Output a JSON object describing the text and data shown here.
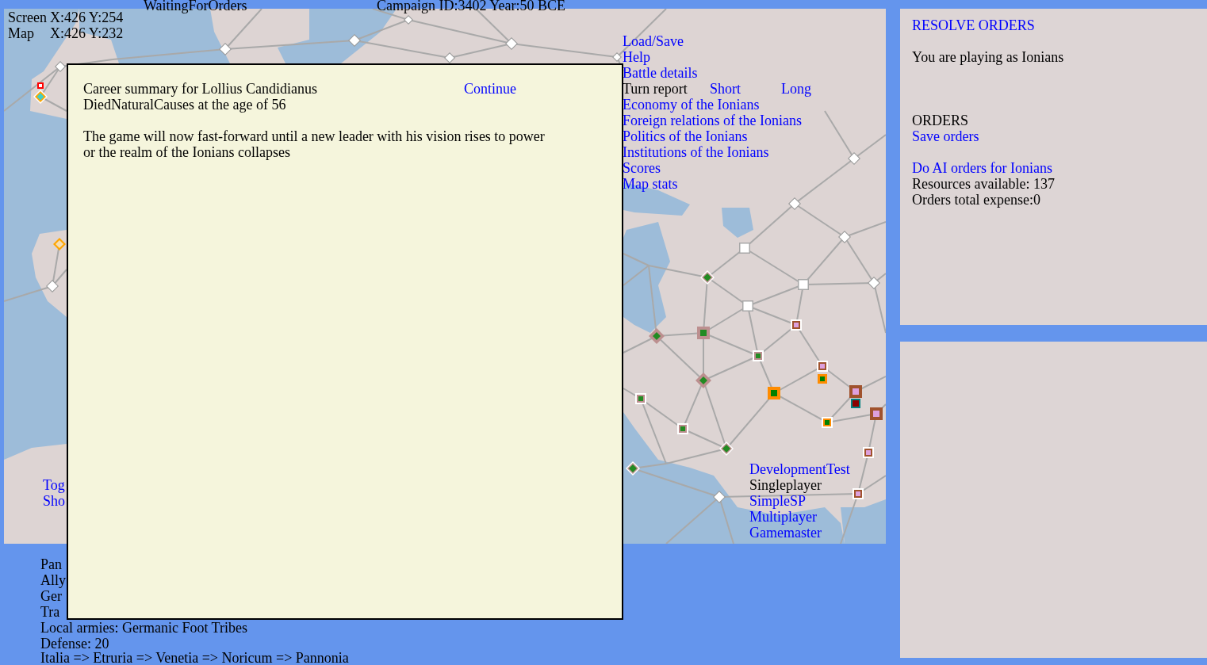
{
  "status": {
    "state_text": "WaitingForOrders",
    "campaign_text": "Campaign ID:3402 Year:50 BCE"
  },
  "coordinates": [
    {
      "label": "Screen",
      "value": "X:426 Y:254"
    },
    {
      "label": "Map",
      "value": "X:426 Y:232"
    }
  ],
  "map_menu": [
    {
      "kind": "link",
      "label": "Load/Save"
    },
    {
      "kind": "link",
      "label": "Help"
    },
    {
      "kind": "link",
      "label": "Battle details"
    },
    {
      "kind": "report",
      "label": "Turn report",
      "options": [
        "Short",
        "Long"
      ]
    },
    {
      "kind": "link",
      "label": "Economy of the Ionians"
    },
    {
      "kind": "link",
      "label": "Foreign relations of the Ionians"
    },
    {
      "kind": "link",
      "label": "Politics of the Ionians"
    },
    {
      "kind": "link",
      "label": "Institutions of the Ionians"
    },
    {
      "kind": "link",
      "label": "Scores"
    },
    {
      "kind": "link",
      "label": "Map stats"
    }
  ],
  "map_toggles": [
    "Tog",
    "Sho"
  ],
  "game_modes": [
    {
      "label": "DevelopmentTest",
      "selected": false
    },
    {
      "label": "Singleplayer",
      "selected": true
    },
    {
      "label": "SimpleSP",
      "selected": false
    },
    {
      "label": "Multiplayer",
      "selected": false
    },
    {
      "label": "Gamemaster",
      "selected": false
    }
  ],
  "province_info": {
    "lines": [
      "Pan",
      "Ally",
      "Ger",
      "Tra",
      "Local armies: Germanic Foot Tribes",
      "Defense: 20"
    ],
    "route": "Italia => Etruria => Venetia => Noricum => Pannonia"
  },
  "dialog": {
    "title": "Career summary for Lollius Candidianus",
    "action": "Continue",
    "cause": "DiedNaturalCauses at the age of 56",
    "message": "The game will now fast-forward until a new leader with his vision rises to power or the realm of the Ionians collapses"
  },
  "orders_panel": {
    "resolve": "RESOLVE ORDERS",
    "playing_as": "You are playing as Ionians",
    "heading": "ORDERS",
    "save": "Save orders",
    "ai_orders": "Do AI orders for Ionians",
    "resources": "Resources available: 137",
    "expense": "Orders total expense:0"
  }
}
